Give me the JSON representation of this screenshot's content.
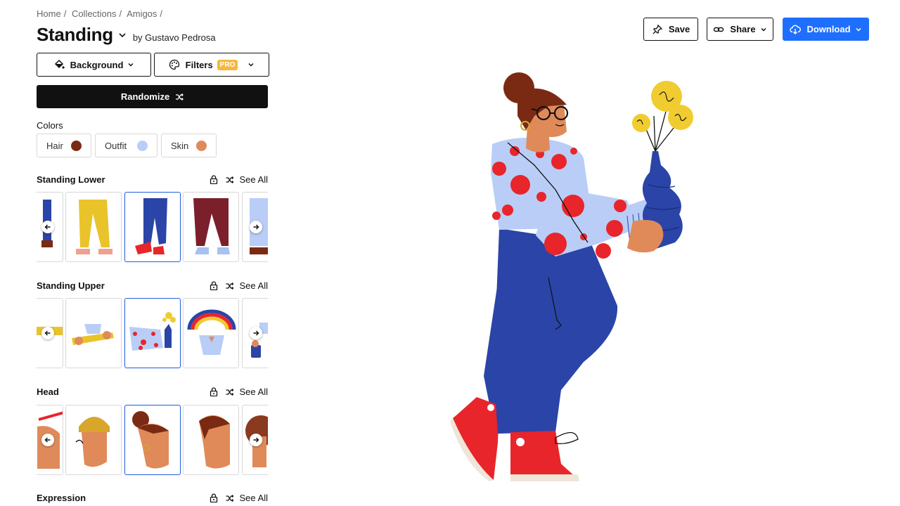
{
  "breadcrumb": [
    "Home",
    "/",
    "Collections",
    "/",
    "Amigos",
    "/"
  ],
  "title": "Standing",
  "author": "by Gustavo Pedrosa",
  "toolbar": {
    "background_label": "Background",
    "filters_label": "Filters",
    "pro_badge": "PRO",
    "randomize_label": "Randomize"
  },
  "colors": {
    "label": "Colors",
    "items": [
      {
        "label": "Hair",
        "color": "#7a2a12"
      },
      {
        "label": "Outfit",
        "color": "#b9cdf7"
      },
      {
        "label": "Skin",
        "color": "#e08a5a"
      }
    ]
  },
  "sections": [
    {
      "title": "Standing Lower",
      "see_all": "See All"
    },
    {
      "title": "Standing Upper",
      "see_all": "See All"
    },
    {
      "title": "Head",
      "see_all": "See All"
    },
    {
      "title": "Expression",
      "see_all": "See All"
    }
  ],
  "actions": {
    "save_label": "Save",
    "share_label": "Share",
    "download_label": "Download"
  },
  "theme": {
    "accent": "#1f6fff",
    "selected_border": "#1f5de0",
    "pro": "#f6b73c",
    "pants": "#2b44a8",
    "shirt": "#b9cdf7",
    "polka": "#e8252b",
    "skin": "#e08a5a",
    "hair": "#7a2a12",
    "flower": "#f0cc30"
  }
}
